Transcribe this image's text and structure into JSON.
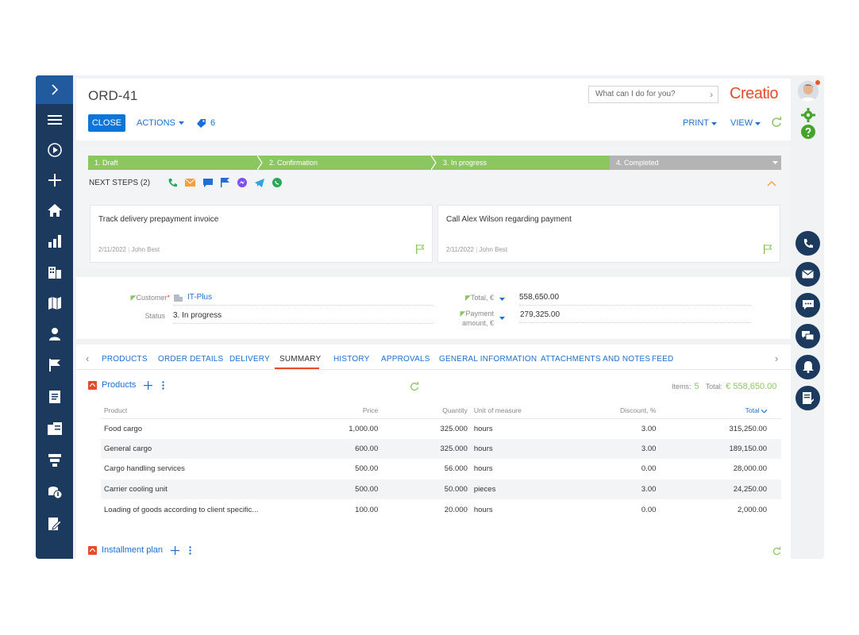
{
  "page": {
    "title": "ORD-41"
  },
  "header": {
    "close_label": "CLOSE",
    "actions_label": "ACTIONS",
    "tag_count": "6",
    "search_placeholder": "What can I do for you?",
    "logo_text": "Creatio",
    "print_label": "PRINT",
    "view_label": "VIEW"
  },
  "stages": [
    {
      "label": "1. Draft",
      "state": "done"
    },
    {
      "label": "2. Confirmation",
      "state": "done"
    },
    {
      "label": "3. In progress",
      "state": "done"
    },
    {
      "label": "4. Completed",
      "state": "todo"
    }
  ],
  "next_steps": {
    "label": "NEXT STEPS (2)",
    "tasks": [
      {
        "name": "Track delivery prepayment invoice",
        "date": "2/11/2022",
        "owner": "John Best"
      },
      {
        "name": "Call Alex Wilson regarding payment",
        "date": "2/11/2022",
        "owner": "John Best"
      }
    ]
  },
  "fields": {
    "customer_label": "Customer",
    "customer_value": "IT-Plus",
    "status_label": "Status",
    "status_value": "3. In progress",
    "total_label": "Total, €",
    "total_value": "558,650.00",
    "payment_label_1": "Payment",
    "payment_label_2": "amount, €",
    "payment_value": "279,325.00"
  },
  "tabs": [
    "PRODUCTS",
    "ORDER DETAILS",
    "DELIVERY",
    "SUMMARY",
    "HISTORY",
    "APPROVALS",
    "GENERAL INFORMATION",
    "ATTACHMENTS AND NOTES",
    "FEED"
  ],
  "active_tab": "SUMMARY",
  "products": {
    "title": "Products",
    "items_label": "Items:",
    "items_count": "5",
    "total_label": "Total:",
    "total_value": "€ 558,650.00",
    "columns": [
      "Product",
      "Price",
      "Quantity",
      "Unit of measure",
      "Discount, %",
      "Total"
    ],
    "rows": [
      [
        "Food cargo",
        "1,000.00",
        "325.000",
        "hours",
        "3.00",
        "315,250.00"
      ],
      [
        "General cargo",
        "600.00",
        "325.000",
        "hours",
        "3.00",
        "189,150.00"
      ],
      [
        "Cargo handling services",
        "500.00",
        "56.000",
        "hours",
        "0.00",
        "28,000.00"
      ],
      [
        "Carrier cooling unit",
        "500.00",
        "50.000",
        "pieces",
        "3.00",
        "24,250.00"
      ],
      [
        "Loading of goods according to client specific...",
        "100.00",
        "20.000",
        "hours",
        "0.00",
        "2,000.00"
      ]
    ]
  },
  "installment": {
    "title": "Installment plan"
  },
  "colors": {
    "nav": "#1b3a5e",
    "accent": "#0d75d8",
    "stage_done": "#8bc660",
    "stage_todo": "#b4b4b4",
    "brand": "#e64b2b"
  }
}
